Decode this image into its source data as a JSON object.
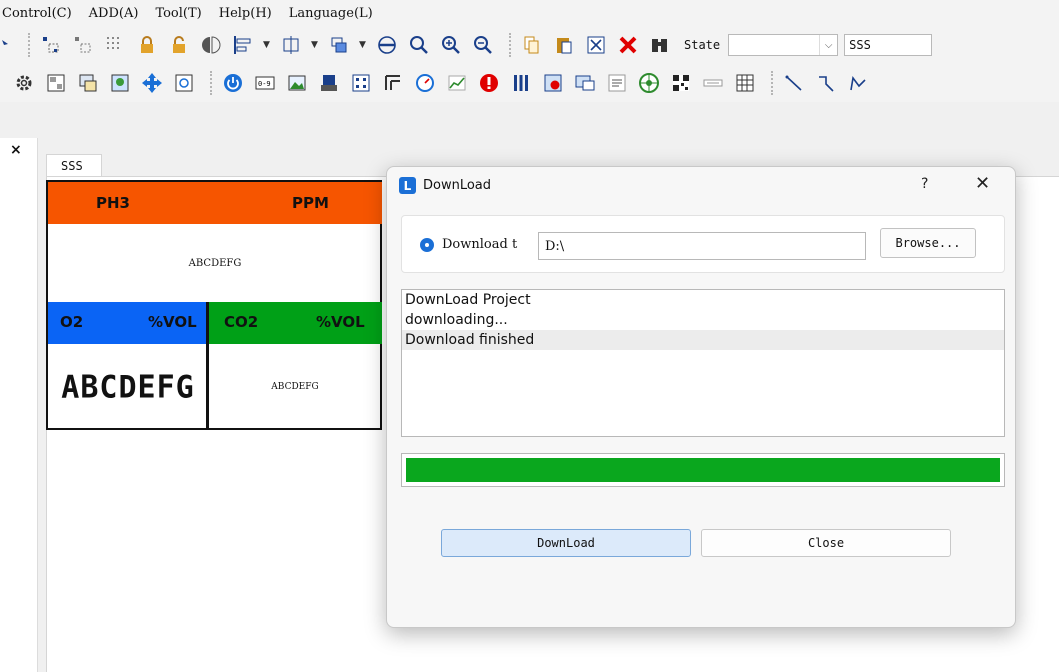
{
  "menu": {
    "items": [
      "Control(C)",
      "ADD(A)",
      "Tool(T)",
      "Help(H)",
      "Language(L)"
    ]
  },
  "toolbar1": {
    "state_label": "State",
    "state_value": "",
    "screen_value": "SSS",
    "icons": [
      "pointer-icon",
      "group-icon",
      "ungroup-icon",
      "grid-icon",
      "lock-icon",
      "unlock-icon",
      "flip-icon",
      "align-left-icon",
      "align-center-icon",
      "layer-icon",
      "line-style-icon",
      "zoom-fit-icon",
      "zoom-in-icon",
      "zoom-out-icon",
      "copy-icon",
      "paste-icon",
      "cut-icon",
      "delete-icon",
      "find-icon"
    ]
  },
  "toolbar2": {
    "icons": [
      "settings-icon",
      "screen-icon",
      "dataset-icon",
      "picture-icon",
      "move-icon",
      "at-icon",
      "power-icon",
      "number-icon",
      "image-icon",
      "gif-icon",
      "keypad-icon",
      "switch-icon",
      "gauge-icon",
      "trend-icon",
      "alarm-icon",
      "bars-icon",
      "record-icon",
      "message-icon",
      "textbox-icon",
      "wheel-icon",
      "qrcode-icon",
      "slider-icon",
      "table-icon",
      "line-icon",
      "polyline-icon",
      "curve-icon"
    ]
  },
  "canvas": {
    "tab_label": "SSS",
    "ph3_label": "PH3",
    "ppm_label": "PPM",
    "main_text": "ABCDEFG",
    "o2_label": "O2",
    "o2_unit": "%VOL",
    "co2_label": "CO2",
    "co2_unit": "%VOL",
    "segment_text": "ABCDEFG",
    "co2_text": "ABCDEFG"
  },
  "dialog": {
    "title": "DownLoad",
    "help": "?",
    "close_glyph": "✕",
    "radio_label": "Download t",
    "path_value": "D:\\",
    "browse_label": "Browse...",
    "log_lines": [
      "DownLoad Project",
      "downloading...",
      "Download finished"
    ],
    "progress_percent": 100,
    "download_label": "DownLoad",
    "close_label": "Close"
  },
  "colors": {
    "orange": "#f65500",
    "blue": "#0a64f5",
    "green": "#00a017",
    "progress": "#0aa71e",
    "accent": "#1b6fd6"
  }
}
